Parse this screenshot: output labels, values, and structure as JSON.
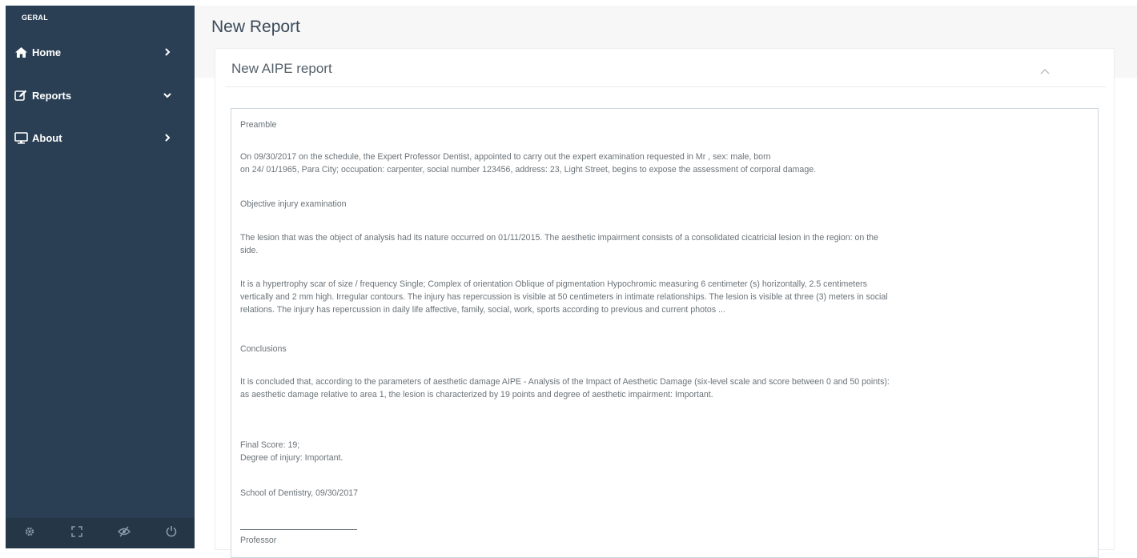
{
  "sidebar": {
    "section_title": "GERAL",
    "items": [
      {
        "label": "Home",
        "icon": "home-icon",
        "arrow": "chevron-right-icon"
      },
      {
        "label": "Reports",
        "icon": "edit-icon",
        "arrow": "chevron-down-icon"
      },
      {
        "label": "About",
        "icon": "monitor-icon",
        "arrow": "chevron-right-icon"
      }
    ],
    "footer_buttons": [
      "settings-icon",
      "fullscreen-icon",
      "eye-slash-icon",
      "power-icon"
    ]
  },
  "page": {
    "title": "New Report"
  },
  "panel": {
    "title": "New AIPE report"
  },
  "report": {
    "preamble_heading": "Preamble",
    "preamble_line1": "On 09/30/2017 on the schedule, the Expert Professor                            Dentist, appointed to carry out the expert examination requested in Mr                              , sex: male, born",
    "preamble_line2": "on 24/ 01/1965, Para City; occupation: carpenter, social number 123456, address: 23, Light Street, begins to expose the assessment of corporal damage.",
    "objective_heading": "Objective injury examination",
    "lesion_line1": "The lesion that was the object of analysis had its nature occurred on 01/11/2015. The aesthetic impairment consists of a consolidated cicatricial lesion in the region: on the",
    "lesion_line2": "side.",
    "scar_line1": "It is a hypertrophy scar of size / frequency Single; Complex of orientation Oblique of pigmentation Hypochromic measuring 6 centimeter (s) horizontally, 2.5 centimeters",
    "scar_line2": "vertically and 2 mm high. Irregular contours. The injury has repercussion is visible at 50 centimeters in intimate relationships. The lesion is visible at three (3) meters in social",
    "scar_line3": "relations. The injury has repercussion in daily life affective, family, social, work, sports according to previous and current photos ...",
    "conclusions_heading": "Conclusions",
    "concl_line1": "It is concluded that, according to the parameters of aesthetic damage AIPE - Analysis of the Impact of Aesthetic Damage (six-level scale and score between 0 and 50 points):",
    "concl_line2": "as aesthetic damage relative to area 1, the lesion is characterized by 19 points and degree of aesthetic impairment: Important.",
    "final_score": "Final Score: 19;",
    "degree": "Degree of injury: Important.",
    "place_date": "School of Dentistry, 09/30/2017",
    "signature": "Professor"
  }
}
